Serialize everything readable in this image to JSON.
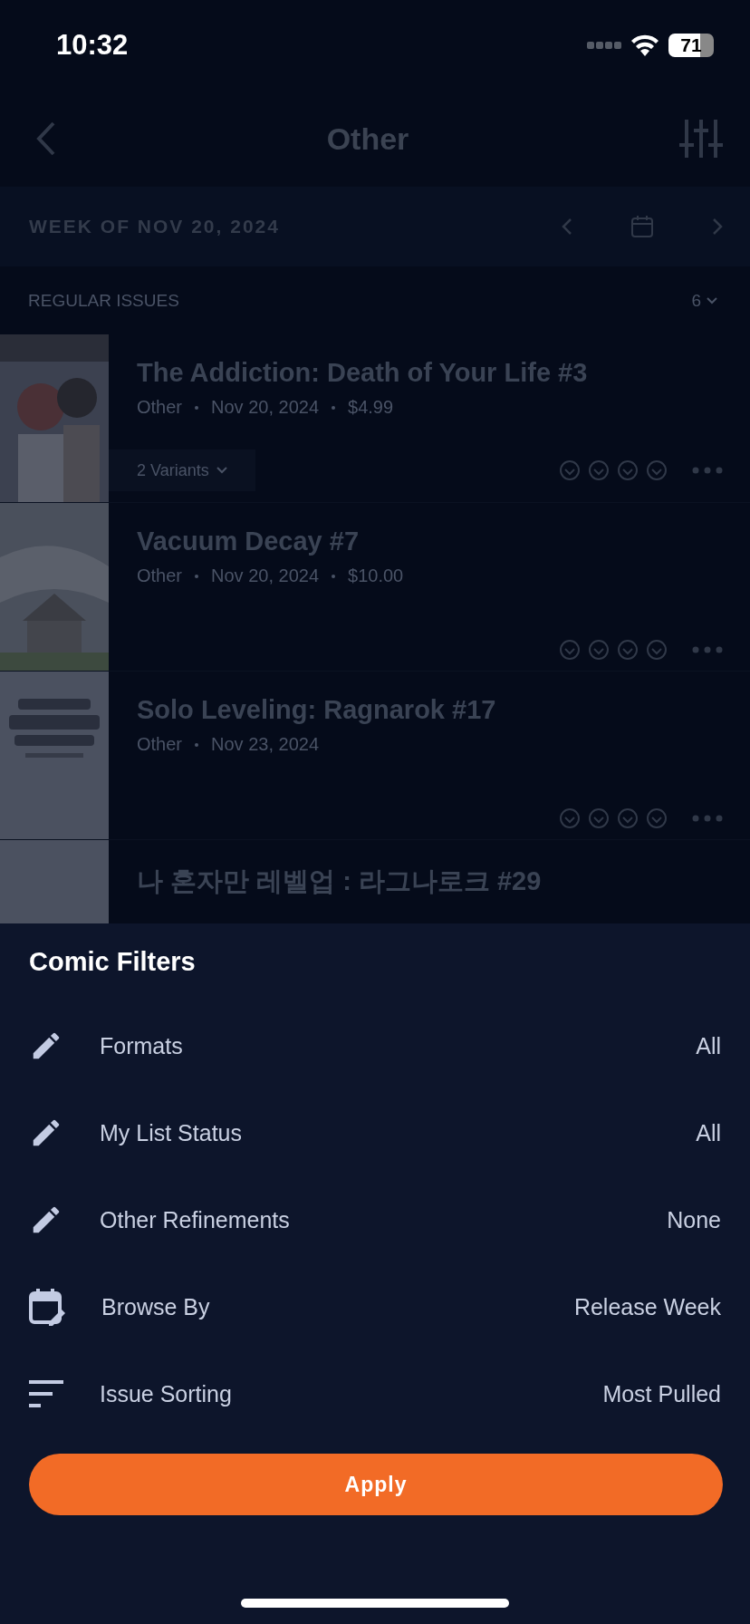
{
  "status_bar": {
    "time": "10:32",
    "battery": "71"
  },
  "nav": {
    "title": "Other"
  },
  "week": {
    "label": "WEEK OF NOV 20, 2024"
  },
  "section": {
    "title": "REGULAR ISSUES",
    "count": "6"
  },
  "issues": [
    {
      "title": "The Addiction: Death of Your Life #3",
      "publisher": "Other",
      "date": "Nov 20, 2024",
      "price": "$4.99",
      "variants": "2 Variants"
    },
    {
      "title": "Vacuum Decay #7",
      "publisher": "Other",
      "date": "Nov 20, 2024",
      "price": "$10.00"
    },
    {
      "title": "Solo Leveling: Ragnarok #17",
      "publisher": "Other",
      "date": "Nov 23, 2024"
    },
    {
      "title": "나 혼자만 레벨업 : 라그나로크 #29"
    }
  ],
  "sheet": {
    "title": "Comic Filters",
    "filters": [
      {
        "kind": "edit",
        "label": "Formats",
        "value": "All"
      },
      {
        "kind": "edit",
        "label": "My List Status",
        "value": "All"
      },
      {
        "kind": "edit",
        "label": "Other Refinements",
        "value": "None"
      },
      {
        "kind": "calendar",
        "label": "Browse By",
        "value": "Release Week"
      },
      {
        "kind": "sort",
        "label": "Issue Sorting",
        "value": "Most Pulled"
      }
    ],
    "apply": "Apply"
  }
}
